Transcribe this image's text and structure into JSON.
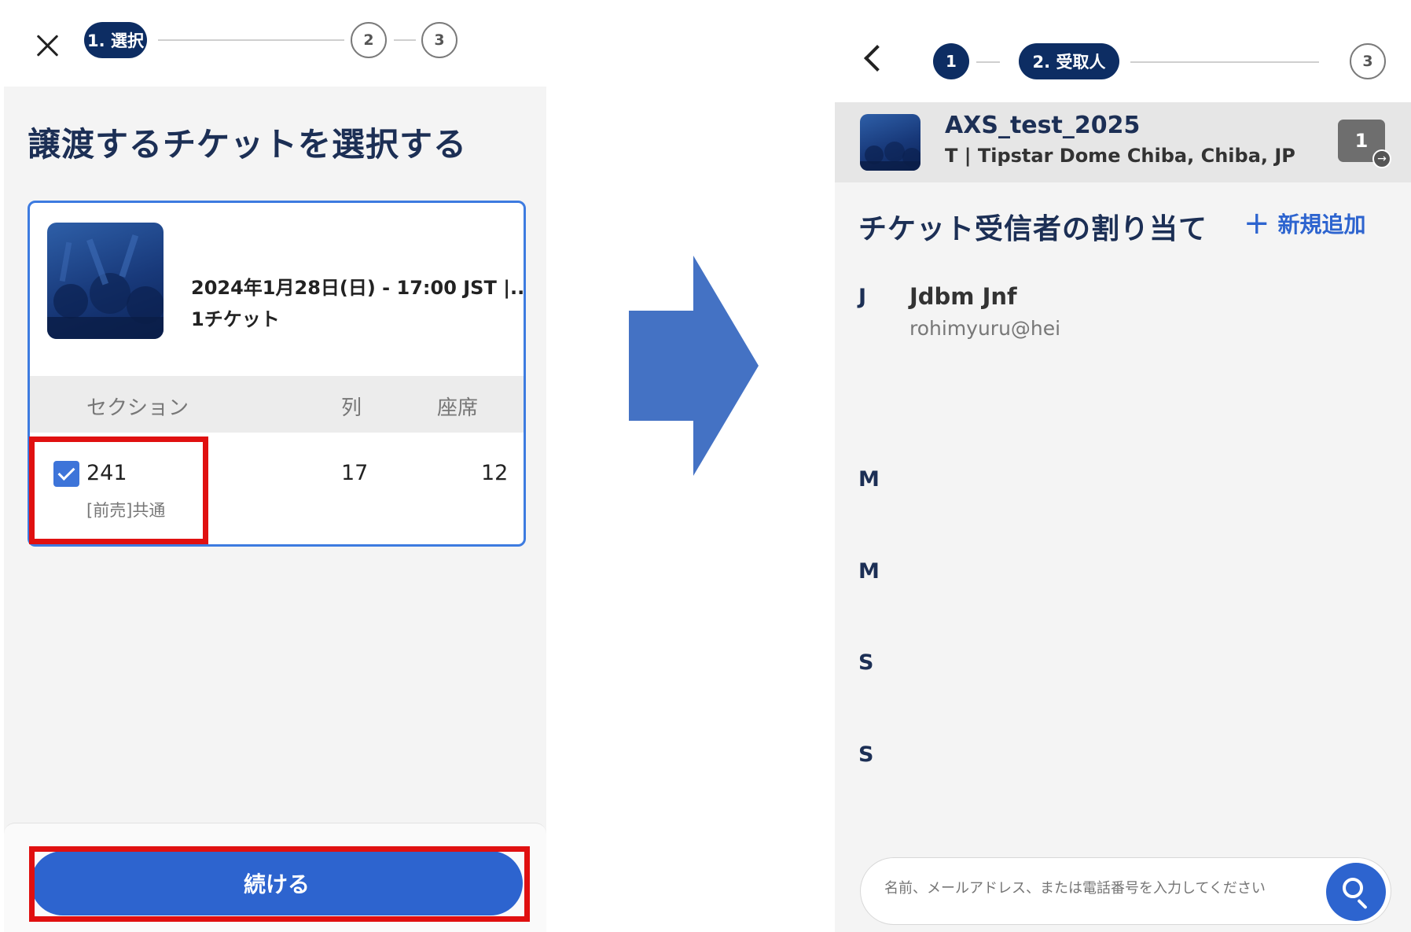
{
  "left": {
    "steps": {
      "step1": "1. 選択",
      "step2": "2",
      "step3": "3"
    },
    "title": "譲渡するチケットを選択する",
    "event": {
      "date": "2024年1月28日(日) - 17:00 JST |...",
      "qty": "1チケット"
    },
    "table": {
      "headers": [
        "セクション",
        "列",
        "座席"
      ],
      "row": {
        "checked": true,
        "section": "241",
        "section_sub": "[前売]共通",
        "row": "17",
        "seat": "12"
      }
    },
    "continue_label": "続ける"
  },
  "right": {
    "steps": {
      "step1": "1",
      "step2": "2. 受取人",
      "step3": "3"
    },
    "event": {
      "name": "AXS_test_2025",
      "venue": "T | Tipstar Dome Chiba, Chiba, JP",
      "ticket_count": "1"
    },
    "assign_title": "チケット受信者の割り当て",
    "add_new_label": "新規追加",
    "contacts": [
      {
        "letter": "J",
        "name": "Jdbm Jnf",
        "email": "rohimyuru@hei"
      },
      {
        "letter": "M"
      },
      {
        "letter": "M"
      },
      {
        "letter": "S"
      },
      {
        "letter": "S"
      }
    ],
    "search": {
      "placeholder": "名前、メールアドレス、または電話番号を入力してください"
    }
  },
  "colors": {
    "navy": "#0d2d63",
    "accent_blue": "#2d64cf",
    "highlight_red": "#e01010",
    "arrow_blue": "#4472c4"
  },
  "icons": [
    "close-icon",
    "back-icon",
    "plus-icon",
    "search-icon",
    "checkbox-checked-icon",
    "ticket-icon",
    "arrow-right-icon"
  ]
}
